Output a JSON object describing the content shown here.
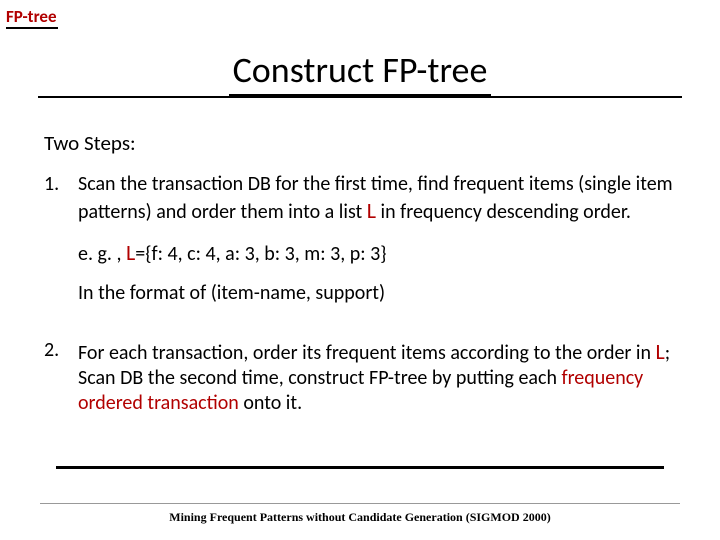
{
  "tag": {
    "label": "FP-tree"
  },
  "title": "Construct FP-tree",
  "subhead": "Two Steps:",
  "steps": [
    {
      "num": "1.",
      "text_a": "Scan the transaction DB for the first time, find frequent items (single item patterns) and order them into a list ",
      "L1": "L",
      "text_b": " in frequency descending order.",
      "eg_prefix": "e. g. , ",
      "eg_L": "L",
      "eg_rest": "={f: 4, c: 4, a: 3, b: 3, m: 3, p: 3}",
      "format_note": "In the format of (item-name, support)"
    },
    {
      "num": "2.",
      "text_a": "For each transaction, order its frequent items according to the order in ",
      "L1": "L",
      "text_b": "; Scan DB the second time, construct FP-tree by putting each ",
      "red_phrase": "frequency ordered transaction",
      "text_c": " onto it."
    }
  ],
  "footer": "Mining Frequent Patterns without Candidate Generation (SIGMOD 2000)"
}
